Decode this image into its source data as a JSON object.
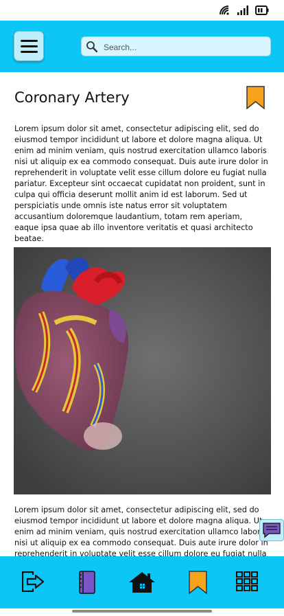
{
  "status_bar": {
    "icons": [
      "wifi-icon",
      "signal-icon",
      "battery-icon"
    ]
  },
  "header": {
    "menu_icon": "hamburger-menu-icon",
    "search": {
      "placeholder": "Search...",
      "value": ""
    }
  },
  "article": {
    "title": "Coronary Artery",
    "bookmark_icon": "bookmark-icon",
    "paragraph_1": "Lorem ipsum dolor sit amet, consectetur adipiscing elit, sed do eiusmod tempor incididunt ut labore et dolore magna aliqua. Ut enim ad minim veniam, quis nostrud exercitation ullamco laboris nisi ut aliquip ex ea commodo consequat. Duis aute irure dolor in reprehenderit in voluptate velit esse cillum dolore eu fugiat nulla pariatur. Excepteur sint occaecat cupidatat non proident, sunt in culpa qui officia deserunt mollit anim id est laborum. Sed ut perspiciatis unde omnis iste natus error sit voluptatem accusantium doloremque laudantium, totam rem aperiam, eaque ipsa quae ab illo inventore veritatis et quasi architecto beatae.",
    "image": "anatomical-heart-model-photo",
    "paragraph_2": "Lorem ipsum dolor sit amet, consectetur adipiscing elit, sed do eiusmod tempor incididunt ut labore et dolore magna aliqua. Ut enim ad minim veniam, quis nostrud exercitation ullamco laboris nisi ut aliquip ex ea commodo consequat. Duis aute irure dolor in reprehenderit in voluptate velit esse cillum dolore eu fugiat nulla"
  },
  "chat_button": {
    "icon": "chat-icon"
  },
  "bottom_nav": {
    "items": [
      "logout-icon",
      "notebook-icon",
      "home-icon",
      "bookmark-icon",
      "grid-icon"
    ]
  },
  "colors": {
    "header_bg": "#0cc6f6",
    "bookmark": "#f7a21b",
    "notebook": "#7b55c8"
  }
}
